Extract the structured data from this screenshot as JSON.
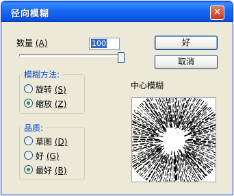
{
  "window": {
    "title": "径向模糊",
    "close_glyph": "✕"
  },
  "amount": {
    "label": "数量",
    "hotkey": "(A)",
    "value": "100",
    "slider_fraction": 1.0
  },
  "buttons": {
    "ok": "好",
    "cancel": "取消"
  },
  "blur_method": {
    "title": "模糊方法:",
    "options": [
      {
        "label": "旋转",
        "hotkey": "(S)",
        "checked": false
      },
      {
        "label": "缩放",
        "hotkey": "(Z)",
        "checked": true
      }
    ]
  },
  "quality": {
    "title": "品质:",
    "options": [
      {
        "label": "草图",
        "hotkey": "(D)",
        "checked": false
      },
      {
        "label": "好",
        "hotkey": "(G)",
        "checked": false
      },
      {
        "label": "最好",
        "hotkey": "(B)",
        "checked": true
      }
    ]
  },
  "preview": {
    "title": "中心模糊",
    "icon": "radial-blur-preview"
  },
  "colors": {
    "title_bar": "#0c55e6",
    "dialog_bg": "#ece9d8",
    "group_label": "#0046d5",
    "radio_dot": "#21a121"
  }
}
